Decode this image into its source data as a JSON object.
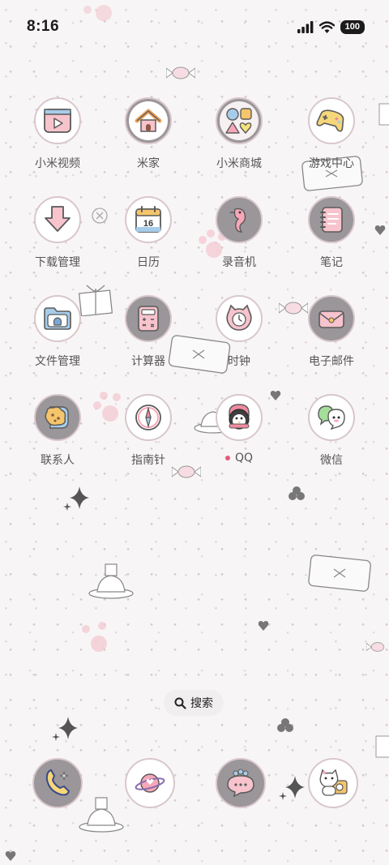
{
  "status_bar": {
    "time": "8:16",
    "battery": "100"
  },
  "apps": [
    {
      "label": "小米视频",
      "icon": "video-play-icon"
    },
    {
      "label": "米家",
      "icon": "house-icon"
    },
    {
      "label": "小米商城",
      "icon": "shapes-icon"
    },
    {
      "label": "游戏中心",
      "icon": "gamepad-icon"
    },
    {
      "label": "下载管理",
      "icon": "download-arrow-icon"
    },
    {
      "label": "日历",
      "icon": "calendar-icon",
      "calendar_day": "16"
    },
    {
      "label": "录音机",
      "icon": "seahorse-icon"
    },
    {
      "label": "笔记",
      "icon": "notebook-icon"
    },
    {
      "label": "文件管理",
      "icon": "folder-icon"
    },
    {
      "label": "计算器",
      "icon": "calculator-icon"
    },
    {
      "label": "时钟",
      "icon": "cat-clock-icon"
    },
    {
      "label": "电子邮件",
      "icon": "envelope-icon"
    },
    {
      "label": "联系人",
      "icon": "cookie-contacts-icon"
    },
    {
      "label": "指南针",
      "icon": "compass-icon"
    },
    {
      "label": "QQ",
      "icon": "penguin-icon",
      "notification_dot": true
    },
    {
      "label": "微信",
      "icon": "chat-ghost-icon"
    }
  ],
  "search": {
    "label": "搜索",
    "icon": "search-icon"
  },
  "dock": [
    {
      "icon": "phone-icon"
    },
    {
      "icon": "planet-heart-icon"
    },
    {
      "icon": "message-bubble-icon"
    },
    {
      "icon": "cat-camera-icon"
    }
  ],
  "colors": {
    "background": "#f8f5f6",
    "icon_ring_grey": "#9a9699",
    "icon_border": "#d8c7cb",
    "pink": "#f3a9b8",
    "notification_dot": "#e85a78"
  }
}
